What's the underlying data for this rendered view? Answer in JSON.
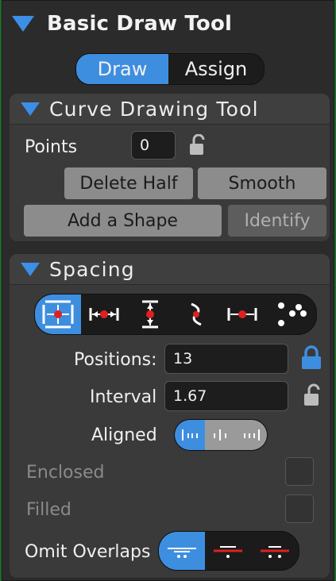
{
  "panel": {
    "title": "Basic Draw Tool"
  },
  "mode": {
    "draw_label": "Draw",
    "assign_label": "Assign",
    "selected": "Draw"
  },
  "curve": {
    "title": "Curve Drawing Tool",
    "points_label": "Points",
    "points_value": "0",
    "delete_half_label": "Delete Half",
    "smooth_label": "Smooth",
    "add_shape_label": "Add a Shape",
    "identify_label": "Identify"
  },
  "spacing": {
    "title": "Spacing",
    "positions_label": "Positions:",
    "positions_value": "13",
    "interval_label": "Interval",
    "interval_value": "1.67",
    "aligned_label": "Aligned",
    "enclosed_label": "Enclosed",
    "filled_label": "Filled",
    "omit_label": "Omit Overlaps"
  },
  "colors": {
    "accent": "#3e8ee0",
    "panel": "#2b2b2b",
    "section": "#3a3a3a",
    "button": "#8c8c8c"
  }
}
